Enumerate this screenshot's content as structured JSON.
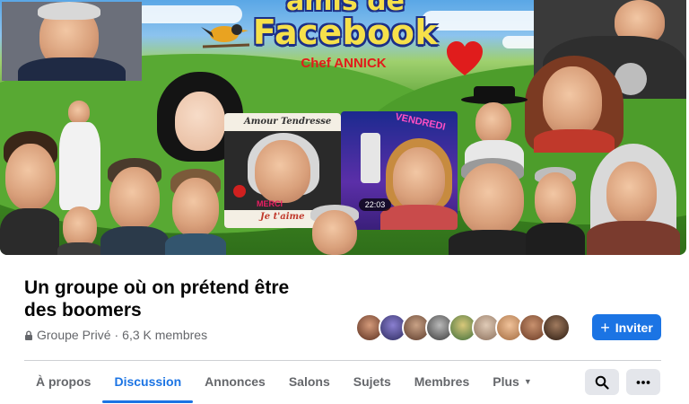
{
  "cover": {
    "title_top": "amis de",
    "title": "Facebook",
    "subtitle": "Chef ANNICK",
    "card_label_1": "Amour Tendresse",
    "card_label_2": "VENDREDI",
    "card_label_3": "Je t'aime",
    "card_label_4": "MERCI",
    "video_time": "22:03"
  },
  "group": {
    "name": "Un groupe où on prétend être des boomers",
    "privacy": "Groupe Privé",
    "separator": "·",
    "member_count": "6,3 K membres"
  },
  "actions": {
    "invite_plus": "+",
    "invite_label": "Inviter"
  },
  "tabs": [
    {
      "label": "À propos"
    },
    {
      "label": "Discussion"
    },
    {
      "label": "Annonces"
    },
    {
      "label": "Salons"
    },
    {
      "label": "Sujets"
    },
    {
      "label": "Membres"
    },
    {
      "label": "Plus"
    }
  ],
  "tab_more_caret": "▼",
  "colors": {
    "accent": "#1b74e4",
    "secondary_text": "#65676b",
    "button_grey": "#e4e6eb"
  },
  "icons": {
    "privacy": "lock-icon",
    "search": "search-icon",
    "more": "more-horizontal-icon"
  }
}
